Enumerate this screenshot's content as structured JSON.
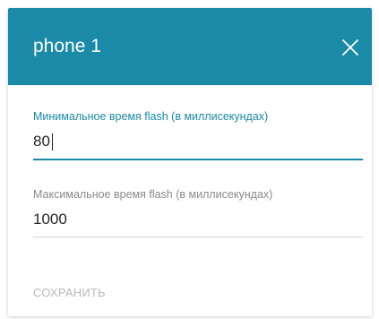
{
  "dialog": {
    "title": "phone 1"
  },
  "fields": {
    "min_flash": {
      "label": "Минимальное время flash (в миллисекундах)",
      "value": "80"
    },
    "max_flash": {
      "label": "Максимальное время flash (в миллисекундах)",
      "value": "1000"
    }
  },
  "actions": {
    "save_label": "СОХРАНИТЬ"
  },
  "colors": {
    "accent": "#1a8aa8",
    "header_text": "#ffffff",
    "label_inactive": "#8a8a8a",
    "disabled_text": "#b9b9b9"
  },
  "icons": {
    "close": "close-icon"
  }
}
